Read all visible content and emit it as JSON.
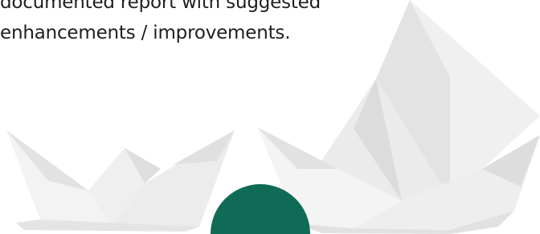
{
  "text": {
    "line1": "documented report with suggested",
    "line2": "enhancements / improvements."
  },
  "colors": {
    "text": "#1e1e1e",
    "paper_light": "#f5f5f5",
    "paper_mid": "#e6e6e6",
    "paper_shadow": "#cfcfcf",
    "accent_green": "#0f6b55"
  }
}
